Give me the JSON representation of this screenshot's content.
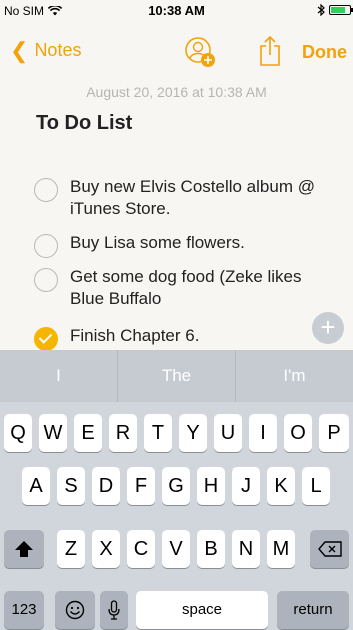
{
  "status": {
    "carrier": "No SIM",
    "time": "10:38 AM"
  },
  "nav": {
    "back_label": "Notes",
    "done_label": "Done"
  },
  "note": {
    "date": "August 20, 2016 at 10:38 AM",
    "title": "To Do List",
    "items": [
      {
        "text": "Buy new Elvis Costello album @ iTunes Store.",
        "checked": false
      },
      {
        "text": "Buy Lisa some flowers.",
        "checked": false
      },
      {
        "text": "Get some dog food (Zeke likes Blue Buffalo",
        "checked": false
      },
      {
        "text": "Finish Chapter 6.",
        "checked": true
      }
    ]
  },
  "suggestions": [
    "I",
    "The",
    "I'm"
  ],
  "keyboard": {
    "row1": [
      "Q",
      "W",
      "E",
      "R",
      "T",
      "Y",
      "U",
      "I",
      "O",
      "P"
    ],
    "row2": [
      "A",
      "S",
      "D",
      "F",
      "G",
      "H",
      "J",
      "K",
      "L"
    ],
    "row3": [
      "Z",
      "X",
      "C",
      "V",
      "B",
      "N",
      "M"
    ],
    "numbers_label": "123",
    "space_label": "space",
    "return_label": "return"
  },
  "colors": {
    "accent": "#f0a30a",
    "checked": "#f6b500"
  },
  "icons": [
    "wifi-icon",
    "bluetooth-icon",
    "battery-icon",
    "chevron-left-icon",
    "add-people-icon",
    "share-icon",
    "plus-icon",
    "shift-icon",
    "emoji-icon",
    "microphone-icon",
    "delete-icon"
  ]
}
